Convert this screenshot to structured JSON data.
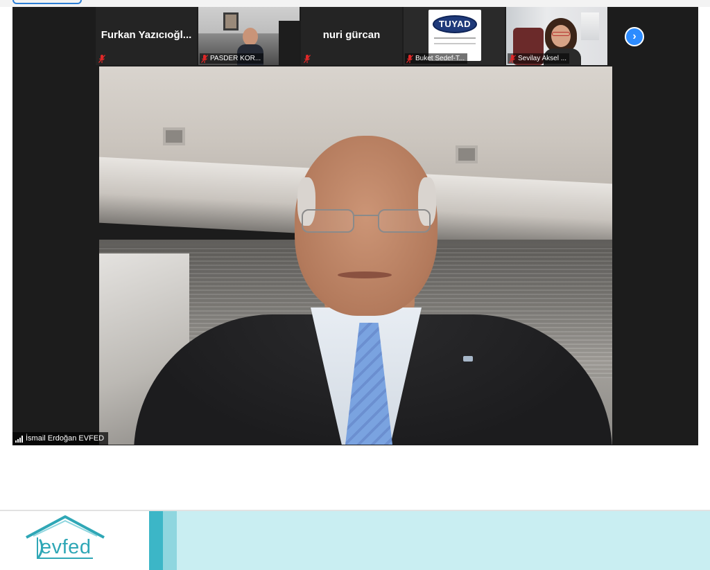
{
  "gallery": {
    "tiles": [
      {
        "kind": "name",
        "name": "Furkan  Yazıcıoğl...",
        "label": ""
      },
      {
        "kind": "video-office",
        "label": "PASDER KOR..."
      },
      {
        "kind": "name",
        "name": "nuri gürcan",
        "label": ""
      },
      {
        "kind": "video-logo",
        "logo_text": "TUYAD",
        "label": "Buket Sedef-T..."
      },
      {
        "kind": "video-woman",
        "label": "Sevilay Aksel ..."
      }
    ],
    "next_icon": "chevron-right-icon",
    "next_glyph": "›"
  },
  "main_speaker": {
    "name": "İsmail Erdoğan EVFED",
    "signal_icon": "signal-bars-icon"
  },
  "footer": {
    "logo_text": "evfed"
  },
  "colors": {
    "zoom_bg": "#1c1c1c",
    "accent_blue": "#2d8cff",
    "muted_red": "#e02828",
    "brand_teal": "#2fa7b6",
    "band_light": "#c9eef2"
  }
}
